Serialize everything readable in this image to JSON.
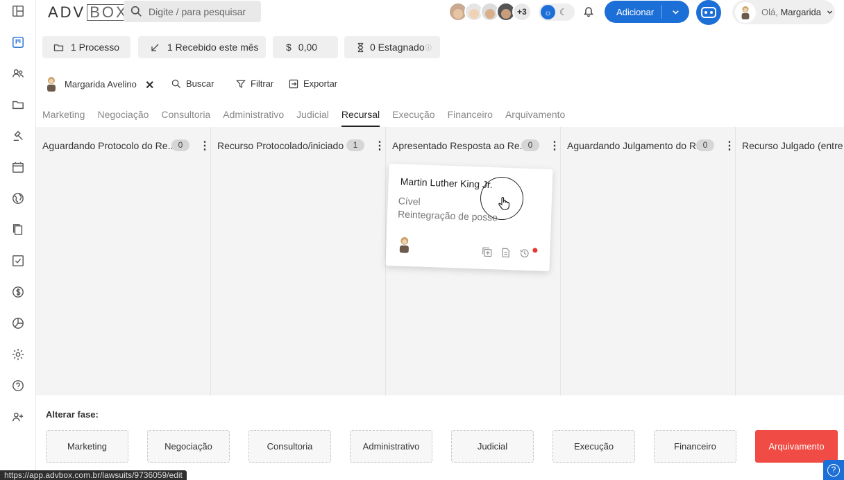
{
  "header": {
    "logo_left": "ADV",
    "logo_right": "BOX",
    "search_placeholder": "Digite / para pesquisar",
    "extra_users": "+3",
    "add_button": "Adicionar",
    "greeting": "Olá,",
    "user_name": "Margarida"
  },
  "stats": {
    "processes": "1 Processo",
    "received": "1 Recebido este mês",
    "currency": "$",
    "amount": "0,00",
    "stagnant": "0 Estagnado"
  },
  "toolbar": {
    "filter_user": "Margarida Avelino",
    "search": "Buscar",
    "filter": "Filtrar",
    "export": "Exportar"
  },
  "tabs": [
    "Marketing",
    "Negociação",
    "Consultoria",
    "Administrativo",
    "Judicial",
    "Recursal",
    "Execução",
    "Financeiro",
    "Arquivamento"
  ],
  "active_tab": "Recursal",
  "columns": [
    {
      "title": "Aguardando Protocolo do Re...",
      "count": "0"
    },
    {
      "title": "Recurso Protocolado/iniciado",
      "count": "1"
    },
    {
      "title": "Apresentado Resposta ao Re...",
      "count": "0"
    },
    {
      "title": "Aguardando Julgamento do R...",
      "count": "0"
    },
    {
      "title": "Recurso Julgado (entre e",
      "count": ""
    }
  ],
  "card": {
    "name": "Martin Luther King Jr.",
    "area": "Cível",
    "action": "Reintegração de posse"
  },
  "phase": {
    "label": "Alterar fase:",
    "buttons": [
      "Marketing",
      "Negociação",
      "Consultoria",
      "Administrativo",
      "Judicial",
      "Execução",
      "Financeiro",
      "Arquivamento"
    ]
  },
  "status_url": "https://app.advbox.com.br/lawsuits/9736059/edit",
  "colors": {
    "accent": "#1d6fd8",
    "danger": "#f04b44"
  }
}
